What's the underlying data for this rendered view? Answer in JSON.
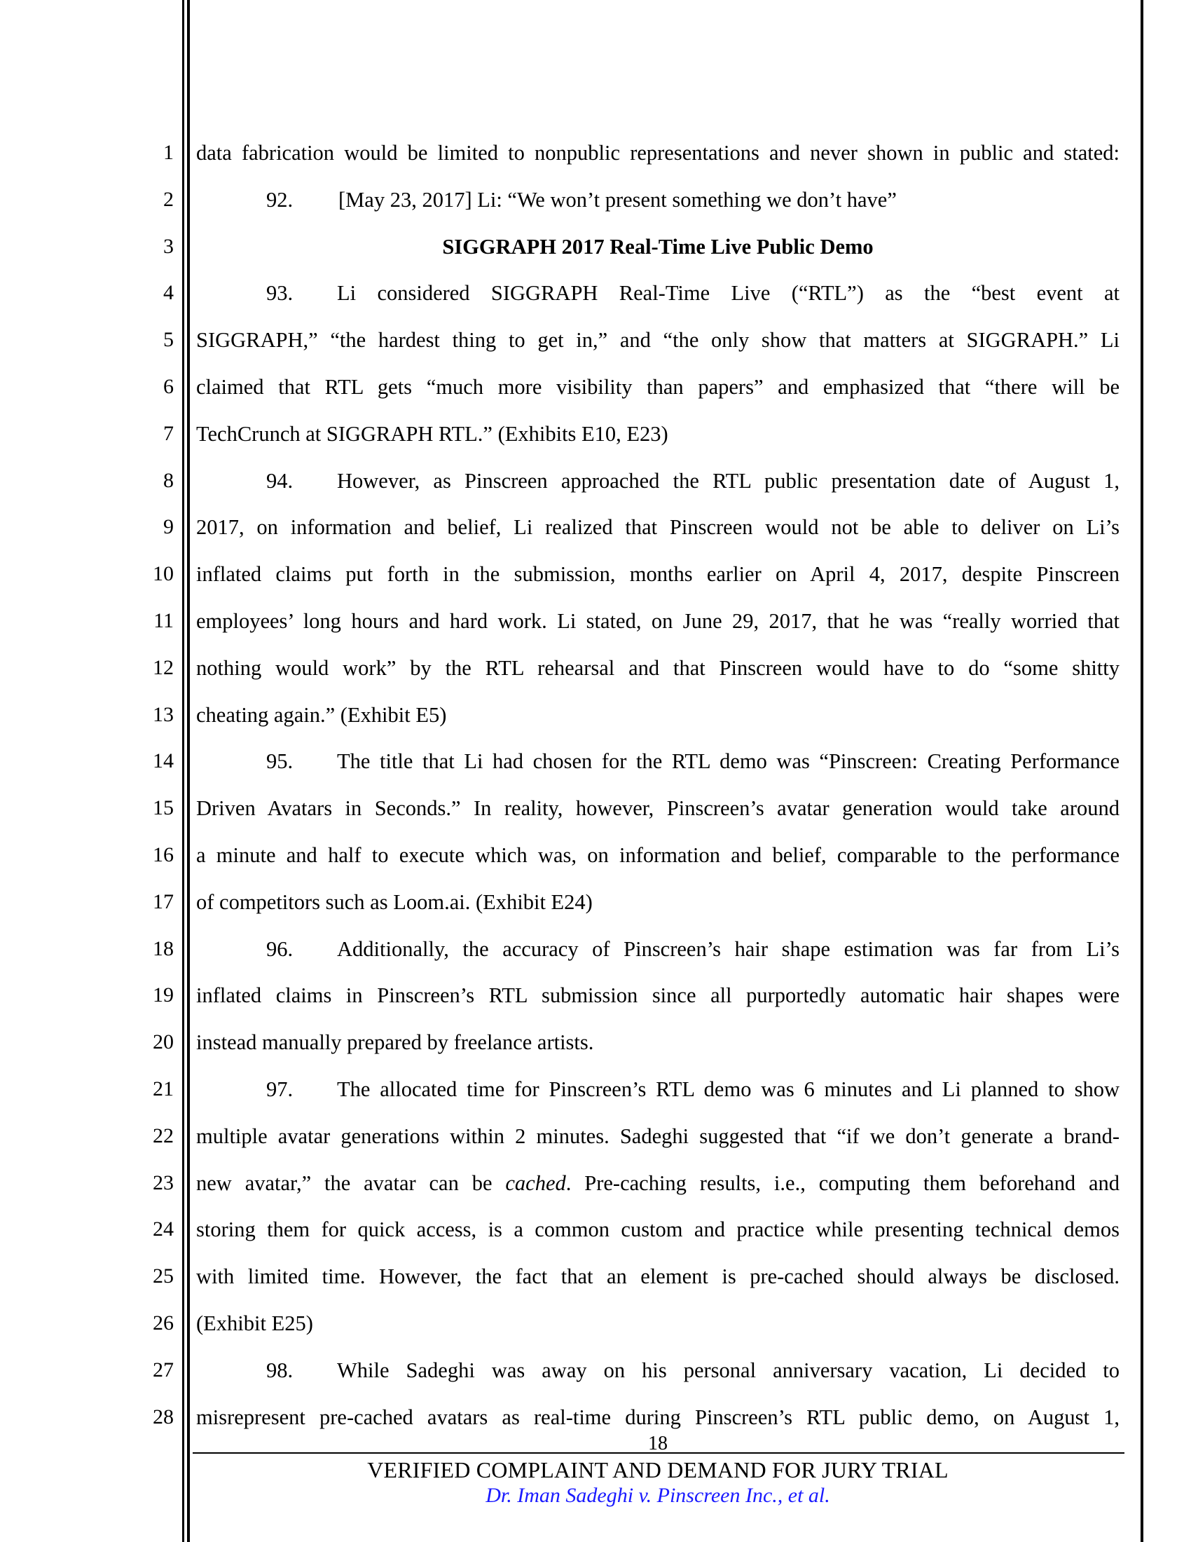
{
  "document": {
    "page_number": "18",
    "footer_title": "VERIFIED COMPLAINT AND DEMAND FOR JURY TRIAL",
    "footer_case": "Dr. Iman Sadeghi v. Pinscreen Inc., et al.",
    "footer_case_color": "#1a1aff",
    "line_numbers": [
      "1",
      "2",
      "3",
      "4",
      "5",
      "6",
      "7",
      "8",
      "9",
      "10",
      "11",
      "12",
      "13",
      "14",
      "15",
      "16",
      "17",
      "18",
      "19",
      "20",
      "21",
      "22",
      "23",
      "24",
      "25",
      "26",
      "27",
      "28"
    ],
    "heading": "SIGGRAPH 2017 Real-Time Live Public Demo",
    "lines": [
      {
        "text": "data fabrication would be limited to nonpublic representations and never shown in public and stated:"
      },
      {
        "num": "92.",
        "text": "[May 23, 2017] Li: “We won’t present something we don’t have”"
      },
      {
        "heading": true
      },
      {
        "num": "93.",
        "text": "Li considered SIGGRAPH Real-Time Live (“RTL”) as the “best event at"
      },
      {
        "text": "SIGGRAPH,” “the hardest thing to get in,” and “the only show that matters at SIGGRAPH.” Li"
      },
      {
        "text": "claimed that RTL gets “much more visibility than papers” and emphasized that “there will be"
      },
      {
        "text": "TechCrunch at SIGGRAPH RTL.” (Exhibits E10, E23)",
        "last": true
      },
      {
        "num": "94.",
        "text": "However, as Pinscreen approached the RTL public presentation date of August 1,"
      },
      {
        "text": "2017, on information and belief, Li realized that Pinscreen would not be able to deliver on Li’s"
      },
      {
        "text": "inflated claims put forth in the submission, months earlier on April 4, 2017, despite Pinscreen"
      },
      {
        "text": "employees’ long hours and hard work. Li stated, on June 29, 2017, that he was “really worried that"
      },
      {
        "text": "nothing would work” by the RTL rehearsal and that Pinscreen would have to do “some shitty"
      },
      {
        "text": "cheating again.” (Exhibit E5)",
        "last": true
      },
      {
        "num": "95.",
        "text": "The title that Li had chosen for the RTL demo was “Pinscreen: Creating Performance"
      },
      {
        "text": "Driven Avatars in Seconds.” In reality, however, Pinscreen’s avatar generation would take around"
      },
      {
        "text": "a minute and half to execute which was, on information and belief, comparable to the performance"
      },
      {
        "text": "of competitors such as Loom.ai. (Exhibit E24)",
        "last": true
      },
      {
        "num": "96.",
        "text": "Additionally, the accuracy of Pinscreen’s hair shape estimation was far from Li’s"
      },
      {
        "text": "inflated claims in Pinscreen’s RTL submission since all purportedly automatic hair shapes were"
      },
      {
        "text": "instead manually prepared by freelance artists.",
        "last": true
      },
      {
        "num": "97.",
        "text": "The allocated time for Pinscreen’s RTL demo was 6 minutes and Li planned to show"
      },
      {
        "text": "multiple avatar generations within 2 minutes. Sadeghi suggested that “if we don’t generate a brand-"
      },
      {
        "pre": "new avatar,” the avatar can be ",
        "em": "cached",
        "post": ". Pre-caching results, i.e., computing them beforehand and"
      },
      {
        "text": "storing them for quick access, is a common custom and practice while presenting technical demos"
      },
      {
        "text": "with limited time. However, the fact that an element is pre-cached should always be disclosed."
      },
      {
        "text": "(Exhibit E25)",
        "last": true
      },
      {
        "num": "98.",
        "text": "While Sadeghi was away on his personal anniversary vacation, Li decided to"
      },
      {
        "text": "misrepresent pre-cached avatars as real-time during Pinscreen’s RTL public demo, on August 1,"
      }
    ]
  }
}
